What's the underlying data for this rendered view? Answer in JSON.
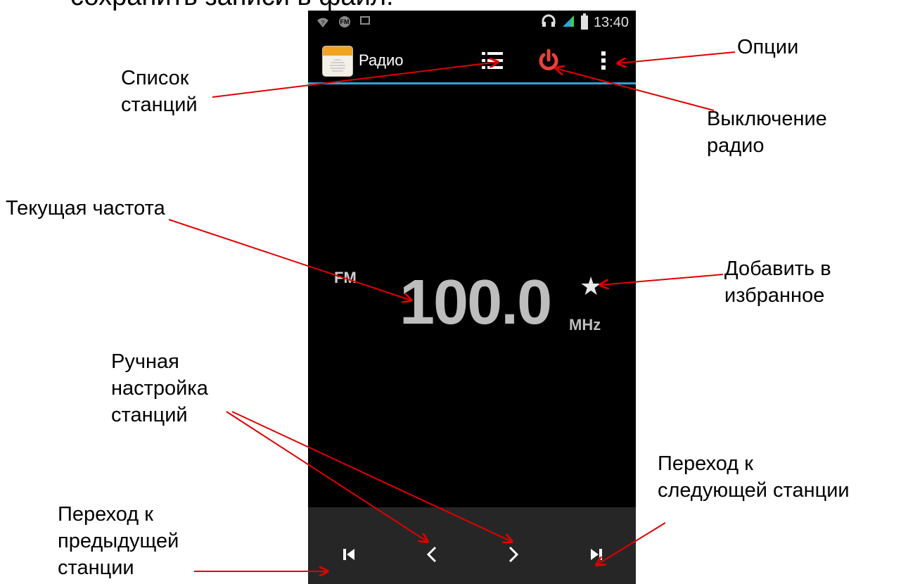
{
  "heading": "сохранить записи в файл.",
  "status_bar": {
    "time": "13:40",
    "icons": [
      "wifi-question-icon",
      "fm-indicator-icon",
      "image-icon",
      "headphones-icon",
      "signal-icon",
      "battery-icon"
    ],
    "fm_icon_text": "FM"
  },
  "action_bar": {
    "app_name": "Радио",
    "accent_color": "#33a0d8",
    "power_color": "#e8433a"
  },
  "tuner": {
    "band": "FM",
    "frequency": "100.0",
    "unit": "MHz"
  },
  "callouts": {
    "station_list": "Список\nстанций",
    "options": "Опции",
    "power_off": "Выключение\nрадио",
    "current_frequency": "Текущая частота",
    "add_favorite": "Добавить в\nизбранное",
    "manual_tuning": "Ручная\nнастройка\nстанций",
    "next_station": "Переход к\nследующей станции",
    "prev_station": "Переход к\nпредыдущей\nстанции"
  },
  "annotation_color": "#e00000"
}
